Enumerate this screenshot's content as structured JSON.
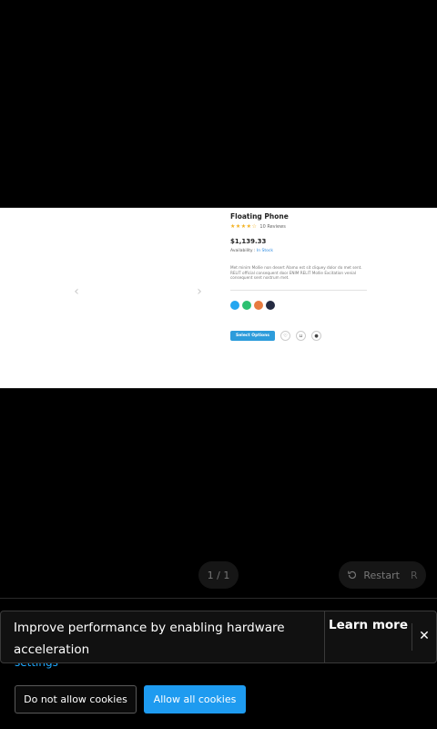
{
  "slide": {
    "arrows": {
      "left": "‹",
      "right": "›"
    },
    "product": {
      "title": "Floating Phone",
      "stars": "★★★★☆",
      "reviews": "10 Reviews",
      "price": "$1,139.33",
      "availability_label": "Availability :",
      "availability_value": "In Stock",
      "description": "Met minim Mollie non desert Alamo est sit cliquey dolor do met sent. RELIT official consequent door ENIM RELIT Mollie Excitation venial consequent sent nostrum met.",
      "swatch_colors": [
        "#23a6f0",
        "#2dc071",
        "#e77c40",
        "#252b42"
      ],
      "select_label": "Select Options",
      "icons": [
        "heart-icon",
        "cart-icon",
        "eye-icon"
      ]
    }
  },
  "pager": {
    "label": "1 / 1"
  },
  "restart": {
    "label": "Restart",
    "shortcut": "R"
  },
  "toast": {
    "message": "Improve performance by enabling hardware acceleration",
    "learn_more": "Learn more",
    "close": "✕"
  },
  "cookie": {
    "settings_link": "settings",
    "deny_label": "Do not allow cookies",
    "allow_label": "Allow all cookies"
  }
}
